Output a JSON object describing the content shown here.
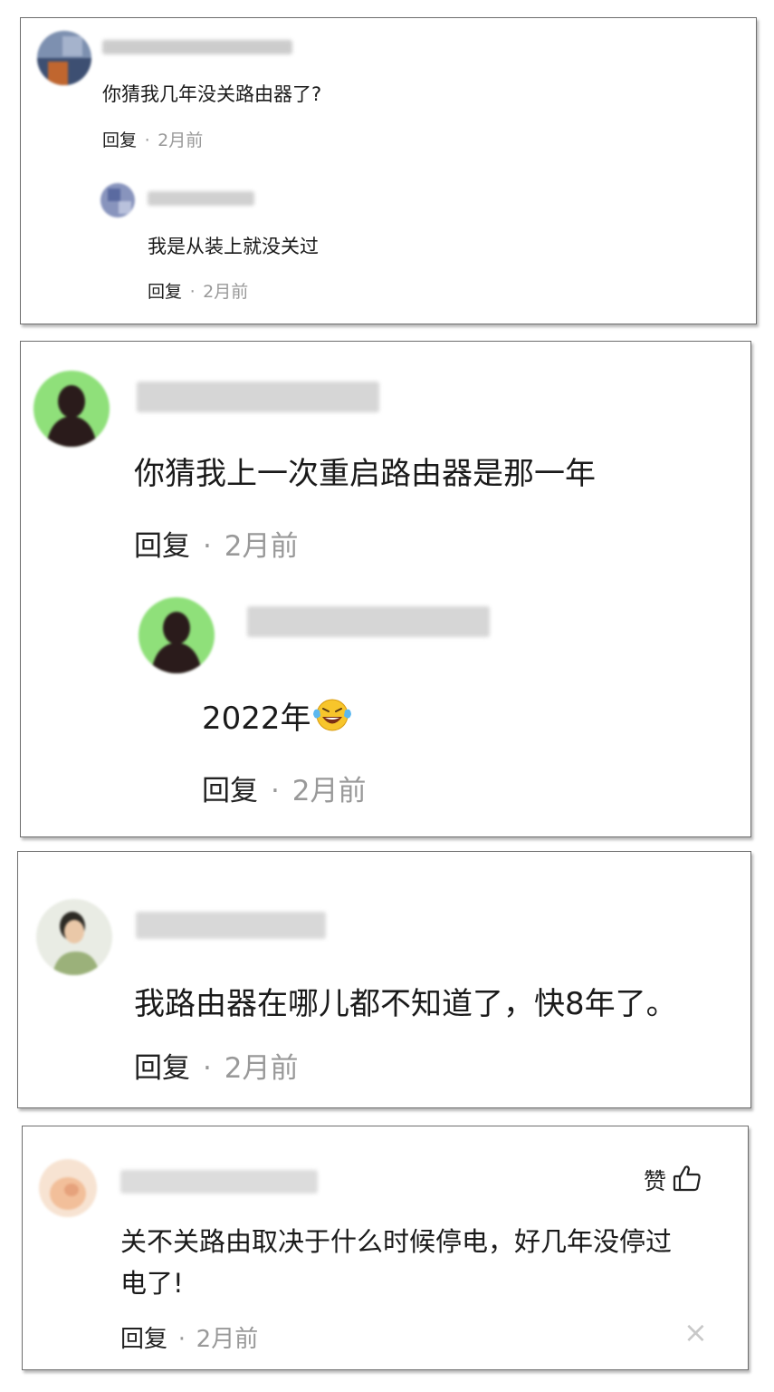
{
  "cards": [
    {
      "comment": {
        "text": "你猜我几年没关路由器了?",
        "reply_label": "回复",
        "dot": "·",
        "time": "2月前"
      },
      "sub_reply": {
        "text": "我是从装上就没关过",
        "reply_label": "回复",
        "dot": "·",
        "time": "2月前"
      }
    },
    {
      "comment": {
        "text": "你猜我上一次重启路由器是那一年",
        "reply_label": "回复",
        "dot": "·",
        "time": "2月前"
      },
      "sub_reply": {
        "text": "2022年",
        "emoji": "crying-laughing-emoji",
        "reply_label": "回复",
        "dot": "·",
        "time": "2月前"
      }
    },
    {
      "comment": {
        "text": "我路由器在哪儿都不知道了，快8年了。",
        "reply_label": "回复",
        "dot": "·",
        "time": "2月前"
      }
    },
    {
      "comment": {
        "text_line1": "关不关路由取决于什么时候停电，好几年没停过",
        "text_line2": "电了!",
        "reply_label": "回复",
        "dot": "·",
        "time": "2月前",
        "like_label": "赞",
        "like_icon": "thumbs-up-icon",
        "close_glyph": "×",
        "close_icon": "close-icon"
      }
    }
  ],
  "colors": {
    "text": "#1a1a1a",
    "meta": "#999999",
    "border": "#6e6e6e",
    "avatar_green": "#8fe07a"
  }
}
